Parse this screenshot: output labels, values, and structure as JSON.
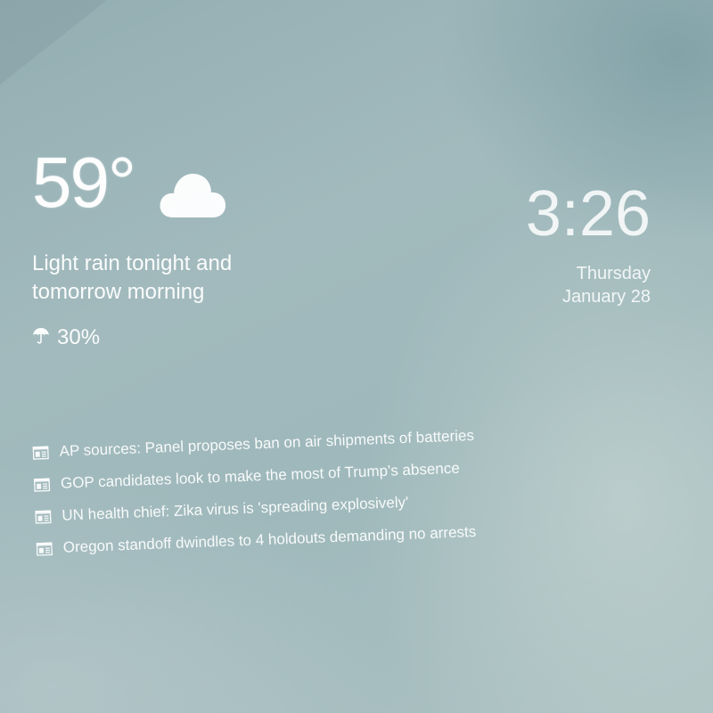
{
  "weather": {
    "temperature": "59°",
    "condition_icon": "cloud-icon",
    "summary": "Light rain tonight and tomorrow morning",
    "precip_icon": "umbrella-icon",
    "precip_chance": "30%"
  },
  "clock": {
    "time": "3:26",
    "day": "Thursday",
    "date": "January 28"
  },
  "news": {
    "item_icon": "newspaper-icon",
    "headlines": [
      "AP sources: Panel proposes ban on air shipments of batteries",
      "GOP candidates look to make the most of Trump's absence",
      "UN health chief: Zika virus is 'spreading explosively'",
      "Oregon standoff dwindles to 4 holdouts demanding no arrests"
    ]
  }
}
